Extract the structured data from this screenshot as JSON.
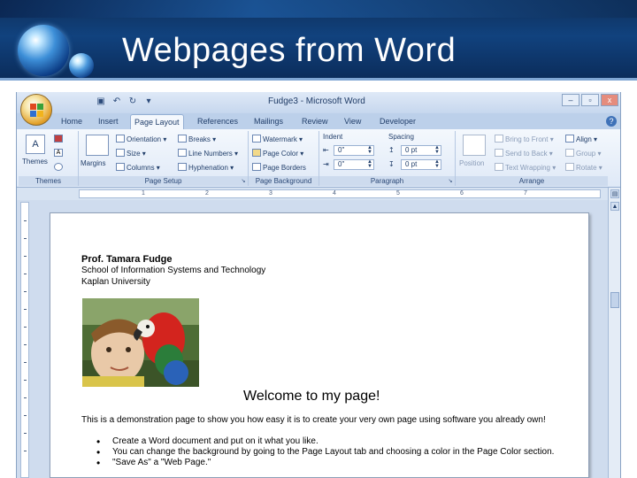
{
  "slide": {
    "title": "Webpages from Word"
  },
  "window": {
    "title": "Fudge3 - Microsoft Word",
    "minimize": "–",
    "maximize": "▫",
    "close": "x"
  },
  "tabs": [
    "Home",
    "Insert",
    "Page Layout",
    "References",
    "Mailings",
    "Review",
    "View",
    "Developer"
  ],
  "active_tab": "Page Layout",
  "ribbon": {
    "themes": {
      "big_label": "Themes",
      "group_label": "Themes"
    },
    "page_setup": {
      "margins_label": "Margins",
      "orientation": "Orientation ▾",
      "size": "Size ▾",
      "columns": "Columns ▾",
      "breaks": "Breaks ▾",
      "line_numbers": "Line Numbers ▾",
      "hyphenation": "Hyphenation ▾",
      "group_label": "Page Setup"
    },
    "page_background": {
      "watermark": "Watermark ▾",
      "page_color": "Page Color ▾",
      "page_borders": "Page Borders",
      "group_label": "Page Background"
    },
    "paragraph": {
      "indent_label": "Indent",
      "spacing_label": "Spacing",
      "indent_left": "0\"",
      "indent_right": "0\"",
      "spacing_before": "0 pt",
      "spacing_after": "0 pt",
      "group_label": "Paragraph"
    },
    "arrange": {
      "position": "Position",
      "bring_to_front": "Bring to Front ▾",
      "send_to_back": "Send to Back ▾",
      "text_wrapping": "Text Wrapping ▾",
      "align": "Align ▾",
      "group": "Group ▾",
      "rotate": "Rotate ▾",
      "group_label": "Arrange"
    }
  },
  "ruler": [
    "1",
    "2",
    "3",
    "4",
    "5",
    "6",
    "7"
  ],
  "document": {
    "author": "Prof. Tamara Fudge",
    "lines": [
      "School of Information Systems and Technology",
      "Kaplan University"
    ],
    "welcome": "Welcome to my page!",
    "intro": "This is a demonstration page to show you how easy it is to create your very own page using software you already own!",
    "bullets": [
      "Create a Word document and put on it what you like.",
      "You can change the background by going to the Page Layout tab and choosing a color in the Page Color section.",
      "\"Save As\" a \"Web Page.\""
    ]
  }
}
